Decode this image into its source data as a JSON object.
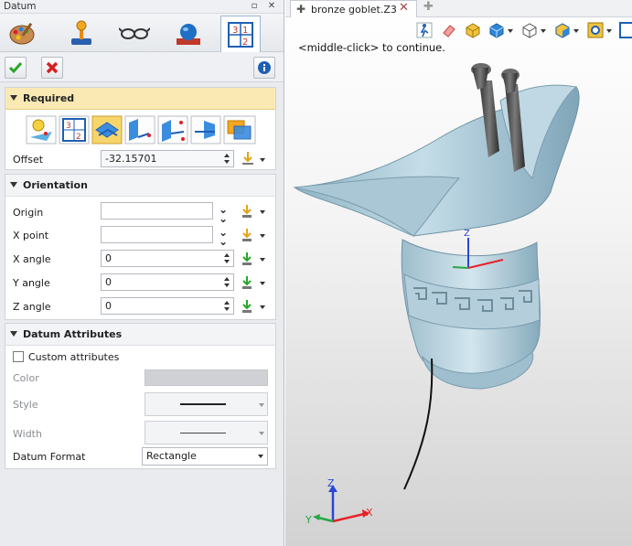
{
  "panel": {
    "title": "Datum",
    "tabs": [
      {
        "name": "palette-icon"
      },
      {
        "name": "joystick-icon"
      },
      {
        "name": "glasses-icon"
      },
      {
        "name": "sphere-icon"
      },
      {
        "name": "datum-number-icon",
        "glyph": "3 1 2"
      }
    ]
  },
  "required": {
    "label": "Required",
    "offset_label": "Offset",
    "offset_value": "-32.15701",
    "method_icons": [
      "bulb-point-icon",
      "number-grid-icon",
      "plane-offset-icon",
      "plane-angle-icon",
      "plane-three-points-icon",
      "plane-normal-icon",
      "plane-tangent-icon"
    ]
  },
  "orientation": {
    "label": "Orientation",
    "rows": [
      {
        "label": "Origin",
        "value": ""
      },
      {
        "label": "X point",
        "value": ""
      },
      {
        "label": "X angle",
        "value": "0"
      },
      {
        "label": "Y angle",
        "value": "0"
      },
      {
        "label": "Z angle",
        "value": "0"
      }
    ]
  },
  "attributes": {
    "label": "Datum Attributes",
    "custom_label": "Custom attributes",
    "color_label": "Color",
    "style_label": "Style",
    "width_label": "Width",
    "format_label": "Datum Format",
    "format_value": "Rectangle"
  },
  "viewport": {
    "doc_name": "bronze goblet.Z3",
    "hint": "<middle-click> to continue.",
    "axes": {
      "x": "X",
      "y": "Y",
      "z": "Z"
    }
  },
  "colors": {
    "accent_yellow": "#fbe9b4",
    "model_blue": "#b7d3df",
    "axis_x": "#e8202a",
    "axis_y": "#28a745",
    "axis_z": "#2a46d8"
  }
}
